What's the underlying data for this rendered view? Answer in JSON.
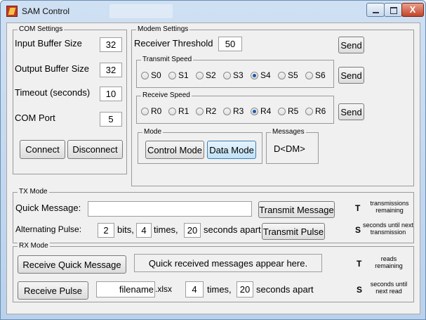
{
  "window": {
    "title": "SAM Control",
    "minimize_icon": "minimize-icon",
    "maximize_icon": "maximize-icon",
    "close_glyph": "X"
  },
  "com_settings": {
    "legend": "COM Settings",
    "input_buffer_label": "Input Buffer Size",
    "input_buffer_value": "32",
    "output_buffer_label": "Output Buffer Size",
    "output_buffer_value": "32",
    "timeout_label": "Timeout (seconds)",
    "timeout_value": "10",
    "com_port_label": "COM Port",
    "com_port_value": "5",
    "connect_label": "Connect",
    "disconnect_label": "Disconnect"
  },
  "modem_settings": {
    "legend": "Modem Settings",
    "receiver_threshold_label": "Receiver Threshold",
    "receiver_threshold_value": "50",
    "send_label": "Send",
    "transmit_speed": {
      "legend": "Transmit Speed",
      "options": [
        "S0",
        "S1",
        "S2",
        "S3",
        "S4",
        "S5",
        "S6"
      ],
      "selected": "S4"
    },
    "receive_speed": {
      "legend": "Receive Speed",
      "options": [
        "R0",
        "R1",
        "R2",
        "R3",
        "R4",
        "R5",
        "R6"
      ],
      "selected": "R4"
    },
    "mode": {
      "legend": "Mode",
      "control_label": "Control Mode",
      "data_label": "Data Mode",
      "active": "Data Mode"
    },
    "messages": {
      "legend": "Messages",
      "value": "D<DM>"
    }
  },
  "tx_mode": {
    "legend": "TX Mode",
    "quick_message_label": "Quick Message:",
    "quick_message_value": "",
    "transmit_message_label": "Transmit Message",
    "alternating_pulse_label": "Alternating Pulse:",
    "bits_value": "2",
    "bits_label": "bits,",
    "times_value": "4",
    "times_label": "times,",
    "seconds_value": "20",
    "seconds_label": "seconds apart",
    "transmit_pulse_label": "Transmit Pulse",
    "t_value": "T",
    "t_caption": "transmissions remaining",
    "s_value": "S",
    "s_caption": "seconds until next transmission"
  },
  "rx_mode": {
    "legend": "RX Mode",
    "receive_quick_label": "Receive Quick Message",
    "quick_display": "Quick received messages appear here.",
    "receive_pulse_label": "Receive Pulse",
    "filename_value": "filename",
    "ext_label": ".xlsx",
    "times_value": "4",
    "times_label": "times,",
    "seconds_value": "20",
    "seconds_label": "seconds apart",
    "t_value": "T",
    "t_caption": "reads remaining",
    "s_value": "S",
    "s_caption": "seconds until next read"
  },
  "colors": {
    "title_bg": "#cfe0f3",
    "close_red": "#c2442a",
    "selected_radio": "#1d58a8",
    "active_button": "#bfe1f7"
  }
}
